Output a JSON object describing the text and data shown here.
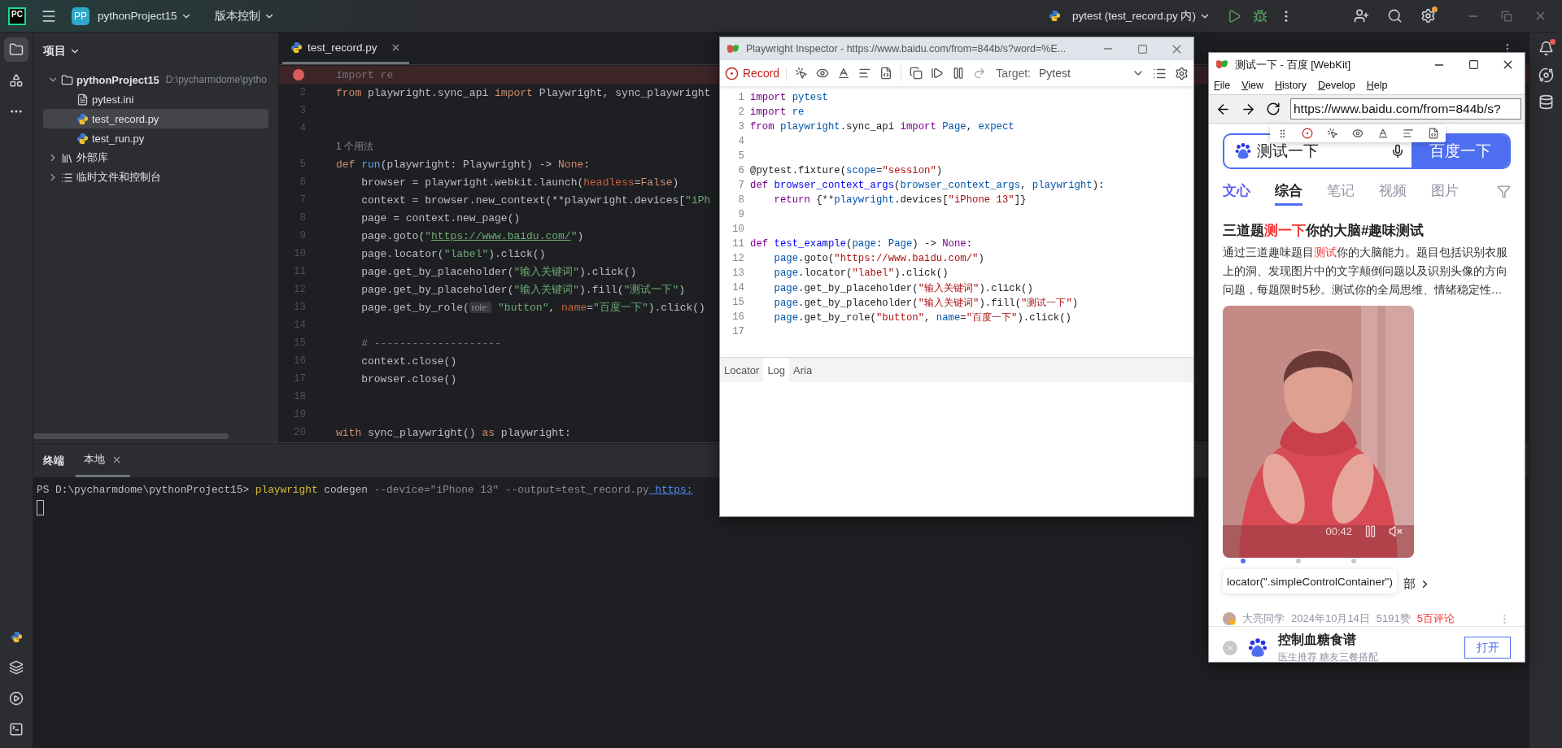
{
  "ide": {
    "toolbar": {
      "app_logo": "PC",
      "project_badge": "PP",
      "project_name": "pythonProject15",
      "vcs_menu": "版本控制",
      "run_config": "pytest (test_record.py 内)",
      "settings_update": true
    },
    "left_tools": [
      {
        "kind": "project",
        "selected": true
      },
      {
        "kind": "structure",
        "selected": false
      },
      {
        "kind": "more",
        "selected": false
      }
    ],
    "left_tools_bottom": [
      {
        "kind": "python_console",
        "selected": false
      },
      {
        "kind": "services",
        "selected": false
      },
      {
        "kind": "run",
        "selected": false
      },
      {
        "kind": "terminal",
        "selected": false
      }
    ],
    "project_panel": {
      "title": "项目",
      "tree": [
        {
          "label": "pythonProject15",
          "path": "D:\\pycharmdome\\pytho",
          "kind": "folder",
          "expanded": true,
          "selected": false,
          "children": [
            {
              "label": "pytest.ini",
              "kind": "ini",
              "selected": false
            },
            {
              "label": "test_record.py",
              "kind": "py",
              "selected": true
            },
            {
              "label": "test_run.py",
              "kind": "py",
              "selected": false
            }
          ]
        },
        {
          "label": "外部库",
          "kind": "library",
          "expanded": false,
          "selected": false
        },
        {
          "label": "临时文件和控制台",
          "kind": "scratch",
          "expanded": false,
          "selected": false
        }
      ]
    },
    "editor": {
      "tabs": [
        {
          "label": "test_record.py",
          "selected": true
        }
      ],
      "lines": [
        {
          "breakpoint": true,
          "tokens": [
            {
              "text": "import re",
              "kind": "unused"
            }
          ]
        },
        {
          "no": "2",
          "breakpoint": false,
          "tokens": [
            {
              "text": "from",
              "kind": "keyword"
            },
            {
              "text": " playwright.sync_api ",
              "kind": "plain"
            },
            {
              "text": "import",
              "kind": "keyword"
            },
            {
              "text": " Playwright, sync_playwright",
              "kind": "plain"
            }
          ]
        },
        {
          "no": "3",
          "breakpoint": false
        },
        {
          "no": "4",
          "breakpoint": false
        },
        {
          "kind": "hint",
          "text": "1 个用法"
        },
        {
          "no": "5",
          "breakpoint": false,
          "tokens": [
            {
              "text": "def",
              "kind": "keyword"
            },
            {
              "text": " run",
              "kind": "function"
            },
            {
              "text": "(playwright: Playwright) -> ",
              "kind": "plain"
            },
            {
              "text": "None",
              "kind": "keyword"
            },
            {
              "text": ":",
              "kind": "plain"
            }
          ]
        },
        {
          "no": "6",
          "breakpoint": false,
          "tokens": [
            {
              "text": "    browser = playwright.webkit.launch(",
              "kind": "plain"
            },
            {
              "text": "headless",
              "kind": "named_arg"
            },
            {
              "text": "=",
              "kind": "plain"
            },
            {
              "text": "False",
              "kind": "keyword"
            },
            {
              "text": ")",
              "kind": "plain"
            }
          ]
        },
        {
          "no": "7",
          "breakpoint": false,
          "tokens": [
            {
              "text": "    context = browser.new_context(**playwright.devices[",
              "kind": "plain"
            },
            {
              "text": "\"iPh",
              "kind": "string"
            }
          ]
        },
        {
          "no": "8",
          "breakpoint": false,
          "tokens": [
            {
              "text": "    page = context.new_page()",
              "kind": "plain"
            }
          ]
        },
        {
          "no": "9",
          "breakpoint": false,
          "tokens": [
            {
              "text": "    page.goto(",
              "kind": "plain"
            },
            {
              "text": "\"",
              "kind": "string"
            },
            {
              "text": "https://www.baidu.com/",
              "kind": "url"
            },
            {
              "text": "\"",
              "kind": "string"
            },
            {
              "text": ")",
              "kind": "plain"
            }
          ]
        },
        {
          "no": "10",
          "breakpoint": false,
          "tokens": [
            {
              "text": "    page.locator(",
              "kind": "plain"
            },
            {
              "text": "\"label\"",
              "kind": "string"
            },
            {
              "text": ").click()",
              "kind": "plain"
            }
          ]
        },
        {
          "no": "11",
          "breakpoint": false,
          "tokens": [
            {
              "text": "    page.get_by_placeholder(",
              "kind": "plain"
            },
            {
              "text": "\"输入关键词\"",
              "kind": "string"
            },
            {
              "text": ").click()",
              "kind": "plain"
            }
          ]
        },
        {
          "no": "12",
          "breakpoint": false,
          "tokens": [
            {
              "text": "    page.get_by_placeholder(",
              "kind": "plain"
            },
            {
              "text": "\"输入关键词\"",
              "kind": "string"
            },
            {
              "text": ").fill(",
              "kind": "plain"
            },
            {
              "text": "\"测试一下\"",
              "kind": "string"
            },
            {
              "text": ")",
              "kind": "plain"
            }
          ]
        },
        {
          "no": "13",
          "breakpoint": false,
          "tokens": [
            {
              "text": "    page.get_by_role(",
              "kind": "plain"
            },
            {
              "text": "role:",
              "kind": "hint"
            },
            {
              "text": " \"button\"",
              "kind": "string"
            },
            {
              "text": ", ",
              "kind": "plain"
            },
            {
              "text": "name",
              "kind": "named_arg"
            },
            {
              "text": "=",
              "kind": "plain"
            },
            {
              "text": "\"百度一下\"",
              "kind": "string"
            },
            {
              "text": ").click()",
              "kind": "plain"
            }
          ]
        },
        {
          "no": "14",
          "breakpoint": false
        },
        {
          "no": "15",
          "breakpoint": false,
          "tokens": [
            {
              "text": "    # --------------------",
              "kind": "comment"
            }
          ]
        },
        {
          "no": "16",
          "breakpoint": false,
          "tokens": [
            {
              "text": "    context.close()",
              "kind": "plain"
            }
          ]
        },
        {
          "no": "17",
          "breakpoint": false,
          "tokens": [
            {
              "text": "    browser.close()",
              "kind": "plain"
            }
          ]
        },
        {
          "no": "18",
          "breakpoint": false
        },
        {
          "no": "19",
          "breakpoint": false
        },
        {
          "no": "20",
          "breakpoint": false,
          "tokens": [
            {
              "text": "with",
              "kind": "keyword"
            },
            {
              "text": " sync_playwright() ",
              "kind": "plain"
            },
            {
              "text": "as",
              "kind": "keyword"
            },
            {
              "text": " playwright:",
              "kind": "plain"
            }
          ]
        }
      ]
    },
    "terminal": {
      "title": "终端",
      "tabs": [
        {
          "label": "本地",
          "selected": true
        }
      ],
      "lines": [
        {
          "tokens": [
            {
              "text": "PS D:\\pycharmdome\\pythonProject15> ",
              "kind": "plain"
            },
            {
              "text": "playwright",
              "kind": "command"
            },
            {
              "text": " codegen ",
              "kind": "plain"
            },
            {
              "text": "--device=\"iPhone 13\" --output=test_record.py",
              "kind": "argument"
            },
            {
              "text": " https:",
              "kind": "link"
            }
          ]
        }
      ]
    },
    "right_tools": [
      {
        "kind": "notifications",
        "unread": true
      },
      {
        "kind": "ai_assistant"
      },
      {
        "kind": "database"
      }
    ]
  },
  "inspector": {
    "title": "Playwright Inspector - https://www.baidu.com/from=844b/s?word=%E...",
    "record": {
      "label": "Record",
      "recording": true
    },
    "target_label": "Target:",
    "target": "Pytest",
    "lines": [
      {
        "no": "1",
        "tokens": [
          {
            "text": "import",
            "kind": "keyword"
          },
          {
            "text": " pytest",
            "kind": "variable"
          }
        ]
      },
      {
        "no": "2",
        "tokens": [
          {
            "text": "import",
            "kind": "keyword"
          },
          {
            "text": " re",
            "kind": "variable"
          }
        ]
      },
      {
        "no": "3",
        "tokens": [
          {
            "text": "from",
            "kind": "keyword"
          },
          {
            "text": " playwright",
            "kind": "variable"
          },
          {
            "text": ".sync_api ",
            "kind": "plain"
          },
          {
            "text": "import",
            "kind": "keyword"
          },
          {
            "text": " Page",
            "kind": "variable"
          },
          {
            "text": ", ",
            "kind": "plain"
          },
          {
            "text": "expect",
            "kind": "variable"
          }
        ]
      },
      {
        "no": "4"
      },
      {
        "no": "5"
      },
      {
        "no": "6",
        "tokens": [
          {
            "text": "@pytest.fixture(",
            "kind": "plain"
          },
          {
            "text": "scope",
            "kind": "variable"
          },
          {
            "text": "=",
            "kind": "plain"
          },
          {
            "text": "\"session\"",
            "kind": "string"
          },
          {
            "text": ")",
            "kind": "plain"
          }
        ]
      },
      {
        "no": "7",
        "tokens": [
          {
            "text": "def",
            "kind": "keyword"
          },
          {
            "text": " browser_context_args",
            "kind": "definition"
          },
          {
            "text": "(",
            "kind": "plain"
          },
          {
            "text": "browser_context_args",
            "kind": "variable"
          },
          {
            "text": ", ",
            "kind": "plain"
          },
          {
            "text": "playwright",
            "kind": "variable"
          },
          {
            "text": "):",
            "kind": "plain"
          }
        ]
      },
      {
        "no": "8",
        "tokens": [
          {
            "text": "    return",
            "kind": "keyword"
          },
          {
            "text": " {**",
            "kind": "plain"
          },
          {
            "text": "playwright",
            "kind": "variable"
          },
          {
            "text": ".devices[",
            "kind": "plain"
          },
          {
            "text": "\"iPhone 13\"",
            "kind": "string"
          },
          {
            "text": "]}",
            "kind": "plain"
          }
        ]
      },
      {
        "no": "9"
      },
      {
        "no": "10"
      },
      {
        "no": "11",
        "tokens": [
          {
            "text": "def",
            "kind": "keyword"
          },
          {
            "text": " test_example",
            "kind": "definition"
          },
          {
            "text": "(",
            "kind": "plain"
          },
          {
            "text": "page",
            "kind": "variable"
          },
          {
            "text": ": ",
            "kind": "plain"
          },
          {
            "text": "Page",
            "kind": "variable"
          },
          {
            "text": ") -> ",
            "kind": "plain"
          },
          {
            "text": "None",
            "kind": "keyword"
          },
          {
            "text": ":",
            "kind": "plain"
          }
        ]
      },
      {
        "no": "12",
        "tokens": [
          {
            "text": "    page",
            "kind": "variable"
          },
          {
            "text": ".goto(",
            "kind": "plain"
          },
          {
            "text": "\"https://www.baidu.com/\"",
            "kind": "string"
          },
          {
            "text": ")",
            "kind": "plain"
          }
        ]
      },
      {
        "no": "13",
        "tokens": [
          {
            "text": "    page",
            "kind": "variable"
          },
          {
            "text": ".locator(",
            "kind": "plain"
          },
          {
            "text": "\"label\"",
            "kind": "string"
          },
          {
            "text": ").click()",
            "kind": "plain"
          }
        ]
      },
      {
        "no": "14",
        "tokens": [
          {
            "text": "    page",
            "kind": "variable"
          },
          {
            "text": ".get_by_placeholder(",
            "kind": "plain"
          },
          {
            "text": "\"输入关键词\"",
            "kind": "string"
          },
          {
            "text": ").click()",
            "kind": "plain"
          }
        ]
      },
      {
        "no": "15",
        "tokens": [
          {
            "text": "    page",
            "kind": "variable"
          },
          {
            "text": ".get_by_placeholder(",
            "kind": "plain"
          },
          {
            "text": "\"输入关键词\"",
            "kind": "string"
          },
          {
            "text": ").fill(",
            "kind": "plain"
          },
          {
            "text": "\"测试一下\"",
            "kind": "string"
          },
          {
            "text": ")",
            "kind": "plain"
          }
        ]
      },
      {
        "no": "16",
        "tokens": [
          {
            "text": "    page",
            "kind": "variable"
          },
          {
            "text": ".get_by_role(",
            "kind": "plain"
          },
          {
            "text": "\"button\"",
            "kind": "string"
          },
          {
            "text": ", ",
            "kind": "plain"
          },
          {
            "text": "name",
            "kind": "variable"
          },
          {
            "text": "=",
            "kind": "plain"
          },
          {
            "text": "\"百度一下\"",
            "kind": "string"
          },
          {
            "text": ").click()",
            "kind": "plain"
          }
        ]
      },
      {
        "no": "17"
      }
    ],
    "tabs": [
      {
        "label": "Locator",
        "selected": false
      },
      {
        "label": "Log",
        "selected": true
      },
      {
        "label": "Aria",
        "selected": false
      }
    ]
  },
  "browser": {
    "title": "测试一下 - 百度 [WebKit]",
    "menu": [
      "File",
      "View",
      "History",
      "Develop",
      "Help"
    ],
    "url": "https://www.baidu.com/from=844b/s?",
    "search": {
      "value": "测试一下",
      "button": "百度一下"
    },
    "tabs": [
      {
        "label": "文心",
        "kind": "brand",
        "selected": false
      },
      {
        "label": "综合",
        "kind": "plain",
        "selected": true
      },
      {
        "label": "笔记",
        "kind": "plain",
        "selected": false
      },
      {
        "label": "视频",
        "kind": "plain",
        "selected": false
      },
      {
        "label": "图片",
        "kind": "plain",
        "selected": false
      }
    ],
    "result": {
      "title": [
        {
          "t": "三道题",
          "hl": false
        },
        {
          "t": "测一下",
          "hl": true
        },
        {
          "t": "你的大脑#趣味测试",
          "hl": false
        }
      ],
      "snippet": [
        {
          "t": "通过三道趣味题目",
          "hl": false
        },
        {
          "t": "测试",
          "hl": true
        },
        {
          "t": "你的大脑能力。题目包括识别衣服上的洞、发现图片中的文字颠倒问题以及识别头像的方向问题，每题限时5秒。测试你的全局思维、情绪稳定性…",
          "hl": false
        }
      ],
      "video": {
        "kind": "picture",
        "time": "00:42",
        "dots": [
          {
            "selected": true
          },
          {
            "selected": false
          },
          {
            "selected": false
          }
        ]
      },
      "locator_tooltip": "locator(\".simpleControlContainer\")",
      "more_link": "部",
      "author": "大亮同学",
      "date": "2024年10月14日",
      "likes": "5191赞",
      "comments": "5百评论"
    },
    "banner": {
      "title": "控制血糖食谱",
      "subtitle": "医生推荐 糖友三餐搭配",
      "button": "打开"
    }
  }
}
